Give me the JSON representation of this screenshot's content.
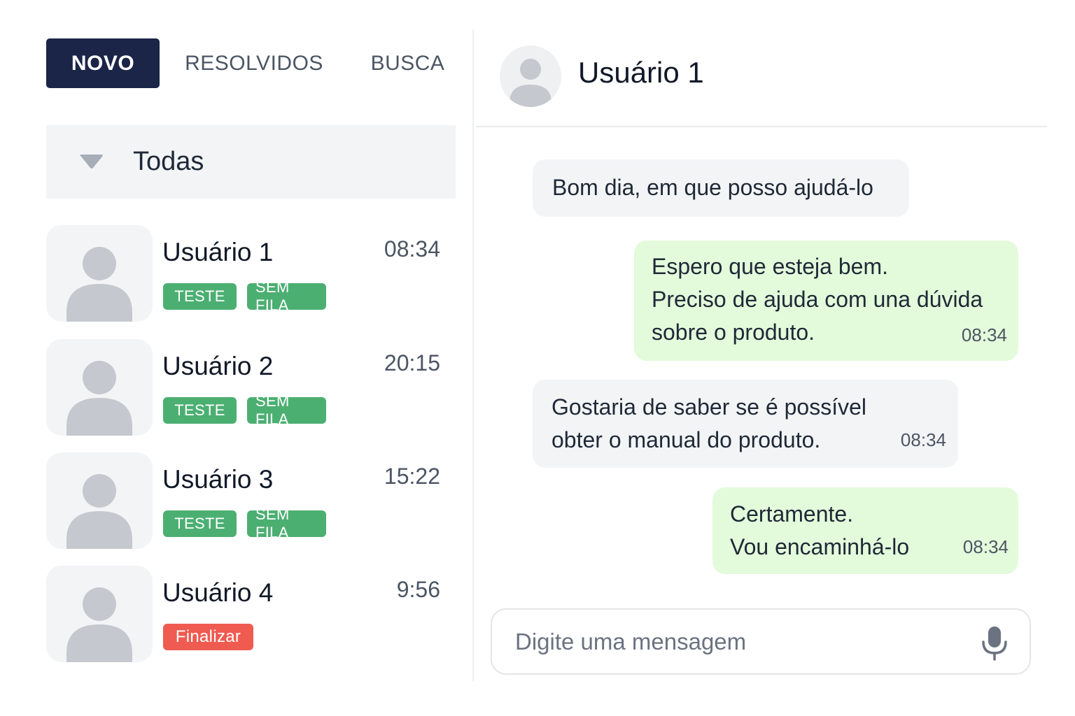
{
  "tabs": [
    {
      "label": "NOVO",
      "active": true
    },
    {
      "label": "RESOLVIDOS",
      "active": false
    },
    {
      "label": "BUSCA",
      "active": false
    }
  ],
  "filter": {
    "label": "Todas",
    "icon": "caret-down-icon"
  },
  "conversations": [
    {
      "name": "Usuário 1",
      "time": "08:34",
      "tags": [
        "TESTE",
        "SEM FILA"
      ]
    },
    {
      "name": "Usuário 2",
      "time": "20:15",
      "tags": [
        "TESTE",
        "SEM FILA"
      ]
    },
    {
      "name": "Usuário 3",
      "time": "15:22",
      "tags": [
        "TESTE",
        "SEM FILA"
      ]
    },
    {
      "name": "Usuário 4",
      "time": "9:56",
      "action": "Finalizar"
    }
  ],
  "chat": {
    "contact_name": "Usuário 1",
    "messages": [
      {
        "direction": "incoming",
        "lines": [
          "Bom dia, em que posso ajudá-lo"
        ],
        "time": ""
      },
      {
        "direction": "outgoing",
        "lines": [
          "Espero que esteja bem.",
          "Preciso de ajuda com una dúvida",
          "sobre o produto."
        ],
        "time": "08:34"
      },
      {
        "direction": "incoming",
        "lines": [
          "Gostaria de saber se é possível",
          "obter o manual do produto."
        ],
        "time": "08:34"
      },
      {
        "direction": "outgoing",
        "lines": [
          "Certamente.",
          "Vou encaminhá-lo"
        ],
        "time": "08:34"
      }
    ]
  },
  "composer": {
    "placeholder": "Digite uma mensagem",
    "mic_icon": "microphone-icon"
  },
  "colors": {
    "tab_active_bg": "#1b2547",
    "tag_green": "#4caf72",
    "tag_red": "#ef5b50",
    "bubble_incoming": "#f3f4f6",
    "bubble_outgoing": "#e3fbdb"
  }
}
